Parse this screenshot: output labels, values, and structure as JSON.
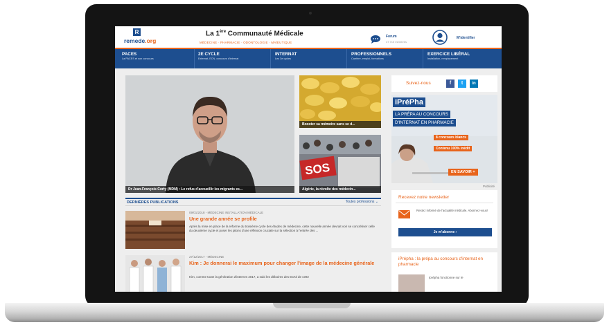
{
  "site": {
    "logo_letter": "R",
    "logo_text_a": "remede",
    "logo_text_b": ".org",
    "tagline_a": "La 1",
    "tagline_sup": "ère",
    "tagline_b": " Communauté Médicale",
    "subtagline": "MÉDECINE · PHARMACIE · ODONTOLOGIE · MAÏEUTIQUE",
    "forum_label": "Forum",
    "forum_count": "47 715 membres",
    "login_label": "M'identifier"
  },
  "nav": [
    {
      "title": "PACES",
      "sub": "La PACES et son concours"
    },
    {
      "title": "2E CYCLE",
      "sub": "Externat, ECN, concours d'internat"
    },
    {
      "title": "INTERNAT",
      "sub": "Les 3e cycles"
    },
    {
      "title": "PROFESSIONNELS",
      "sub": "Carrière, emploi, formations"
    },
    {
      "title": "EXERCICE LIBÉRAL",
      "sub": "Installation, remplacement"
    }
  ],
  "featured": {
    "main_caption": "Dr Jean-François Corty (MDM) : Le refus d'accueillir les migrants es...",
    "side1_caption": "Booster sa mémoire sans se d...",
    "side2_caption": "Algérie, la révolte des médecin...",
    "sign_text": "SOS"
  },
  "publications": {
    "title": "DERNIÈRES PUBLICATIONS",
    "filter": "Toutes professions",
    "articles": [
      {
        "meta": "09/01/2018 - MÉDECINE INSTALLATION MÉDICALE",
        "title": "Une grande année se profile",
        "text": "Après la mise en place de la réforme du troisième cycle des études de médecine, cette nouvelle année devrait voir se concrétiser celle du deuxième cycle et poser les jalons d'une réflexion cruciale sur la sélection à l'entrée des ..."
      },
      {
        "meta": "27/12/2017 - MÉDECINE",
        "title": "Kim : Je donnerai le maximum pour changer l'image de la médecine générale",
        "text": "Kim, comme toute la génération d'internes 2017, a subi les déboires des ECNi de cette"
      }
    ]
  },
  "sidebar": {
    "follow_label": "Suivez-nous",
    "social": [
      "f",
      "t",
      "in"
    ],
    "ad": {
      "logo": "iPréPha",
      "line1": "LA PRÉPA AU CONCOURS",
      "line2": "D'INTERNAT EN PHARMACIE",
      "bullet1": "8 concours blancs",
      "bullet2": "Contenu 100% inédit",
      "cta": "EN SAVOIR +",
      "publicite": "Publicité"
    },
    "newsletter": {
      "title": "Recevez notre newsletter",
      "text": "Restez informé de l'actualité médicale. Abonnez-vous!",
      "button": "Je m'abonne"
    },
    "prepha": {
      "title": "iPrépha : la prépa au concours d'internat en pharmacie",
      "text": "Iprépha fonctionne sur le"
    }
  },
  "colors": {
    "brand_blue": "#1d4e8f",
    "brand_orange": "#e8641b"
  }
}
